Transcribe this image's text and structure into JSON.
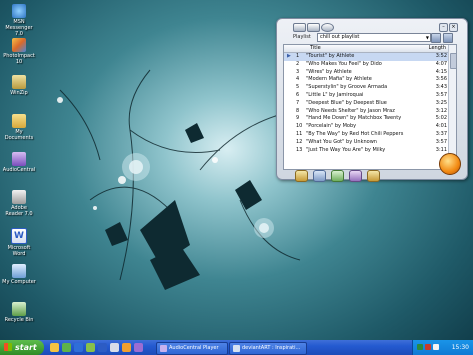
{
  "desktop": {
    "icons": [
      {
        "label": "MSN Messenger 7.0",
        "icon": "msn-icon",
        "color": "#3d8fd4"
      },
      {
        "label": "PhotoImpact 10",
        "icon": "photoimpact-icon",
        "color": "#e3a23a"
      },
      {
        "label": "WinZip",
        "icon": "winzip-icon",
        "color": "#c9b25a"
      },
      {
        "label": "My Documents",
        "icon": "folder-icon",
        "color": "#e8c75a"
      },
      {
        "label": "AudioCentral",
        "icon": "audiocentral-icon",
        "color": "#9b6dd2"
      },
      {
        "label": "Adobe Reader 7.0",
        "icon": "adobe-reader-icon",
        "color": "#c4c4c4"
      },
      {
        "label": "Microsoft Word",
        "icon": "word-icon",
        "color": "#2c5cc4"
      },
      {
        "label": "My Computer",
        "icon": "my-computer-icon",
        "color": "#7ab0e0"
      },
      {
        "label": "Recycle Bin",
        "icon": "recycle-bin-icon",
        "color": "#6fb04a"
      }
    ]
  },
  "player": {
    "playlist_label": "Playlist",
    "playlist_value": "chill out playlist",
    "columns": {
      "title": "Title",
      "length": "Length"
    },
    "tracks": [
      {
        "num": "1",
        "title": "\"Tourist\" by Athlete",
        "length": "3:52",
        "playing": true
      },
      {
        "num": "2",
        "title": "\"Who Makes You Feel\" by Dido",
        "length": "4:07",
        "playing": false
      },
      {
        "num": "3",
        "title": "\"Wires\" by Athlete",
        "length": "4:15",
        "playing": false
      },
      {
        "num": "4",
        "title": "\"Modern Mafia\" by Athlete",
        "length": "3:56",
        "playing": false
      },
      {
        "num": "5",
        "title": "\"Superstylin\" by Groove Armada",
        "length": "3:43",
        "playing": false
      },
      {
        "num": "6",
        "title": "\"Little L\" by Jamiroquai",
        "length": "3:57",
        "playing": false
      },
      {
        "num": "7",
        "title": "\"Deepest Blue\" by Deepest Blue",
        "length": "3:25",
        "playing": false
      },
      {
        "num": "8",
        "title": "\"Who Needs Shelter\" by Jason Mraz",
        "length": "3:12",
        "playing": false
      },
      {
        "num": "9",
        "title": "\"Hand Me Down\" by Matchbox Twenty",
        "length": "5:02",
        "playing": false
      },
      {
        "num": "10",
        "title": "\"Porcelain\" by Moby",
        "length": "4:01",
        "playing": false
      },
      {
        "num": "11",
        "title": "\"By The Way\" by Red Hot Chili Peppers",
        "length": "3:37",
        "playing": false
      },
      {
        "num": "12",
        "title": "\"What You Got\" by Unknown",
        "length": "3:57",
        "playing": false
      },
      {
        "num": "13",
        "title": "\"Just The Way You Are\" by Milky",
        "length": "3:11",
        "playing": false
      }
    ]
  },
  "taskbar": {
    "start_label": "start",
    "tasks": [
      {
        "label": "AudioCentral Player"
      },
      {
        "label": "deviantART : Inspirati..."
      }
    ],
    "clock": "15:30"
  }
}
